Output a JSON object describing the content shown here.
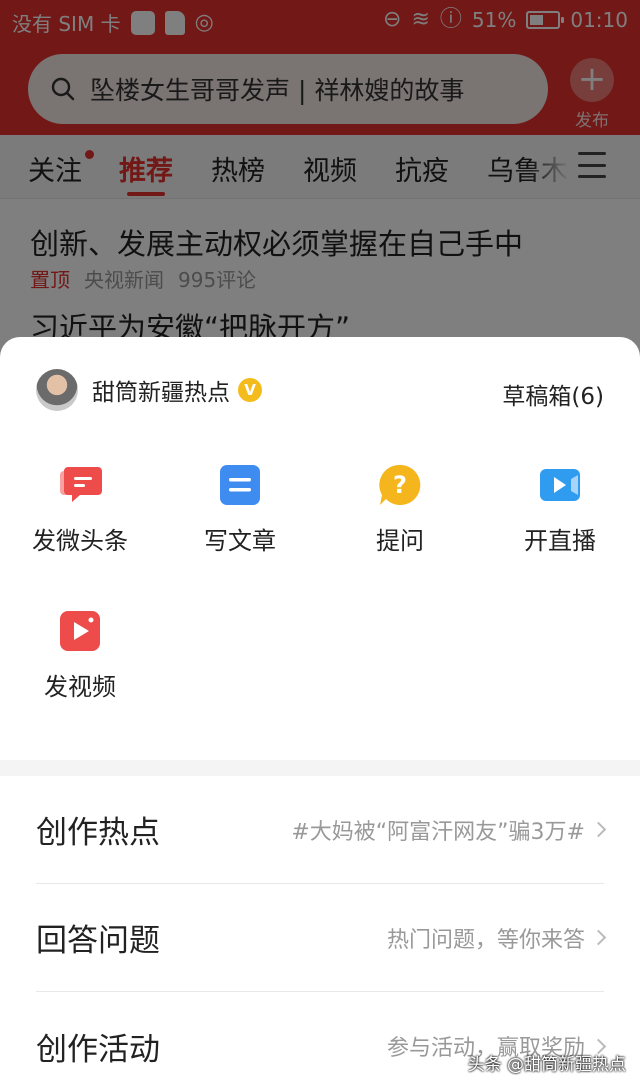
{
  "status_bar": {
    "carrier": "没有 SIM 卡",
    "battery_percent": "51%",
    "battery_level": 0.51,
    "time": "01:10"
  },
  "search": {
    "text": "坠楼女生哥哥发声 | 祥林嫂的故事"
  },
  "publish": {
    "label": "发布"
  },
  "tabs": [
    {
      "label": "关注",
      "has_dot": true
    },
    {
      "label": "推荐",
      "active": true
    },
    {
      "label": "热榜"
    },
    {
      "label": "视频"
    },
    {
      "label": "抗疫"
    },
    {
      "label": "乌鲁木"
    }
  ],
  "feed": {
    "items": [
      {
        "title": "创新、发展主动权必须掌握在自己手中",
        "pin": "置顶",
        "source": "央视新闻",
        "comments": "995评论"
      },
      {
        "title": "习近平为安徽“把脉开方”"
      }
    ]
  },
  "sheet": {
    "account_name": "甜筒新疆热点",
    "verified_mark": "V",
    "drafts": "草稿箱(6)",
    "actions": [
      {
        "label": "发微头条",
        "icon": "micro-post-icon",
        "color": "#ee4b4b"
      },
      {
        "label": "写文章",
        "icon": "article-icon",
        "color": "#3f8cf0"
      },
      {
        "label": "提问",
        "icon": "question-icon",
        "color": "#f5b51c"
      },
      {
        "label": "开直播",
        "icon": "live-camera-icon",
        "color": "#2f9cf0"
      },
      {
        "label": "发视频",
        "icon": "video-icon",
        "color": "#ee4b4b"
      }
    ],
    "rows": [
      {
        "title": "创作热点",
        "hint": "#大妈被“阿富汗网友”骗3万#"
      },
      {
        "title": "回答问题",
        "hint": "热门问题，等你来答"
      },
      {
        "title": "创作活动",
        "hint": "参与活动，赢取奖励"
      }
    ]
  },
  "watermark": "头条 @甜筒新疆热点",
  "colors": {
    "brand_red": "#e5302c",
    "sheet_bg": "#ffffff",
    "overlay": "rgba(0,0,0,0.5)"
  }
}
